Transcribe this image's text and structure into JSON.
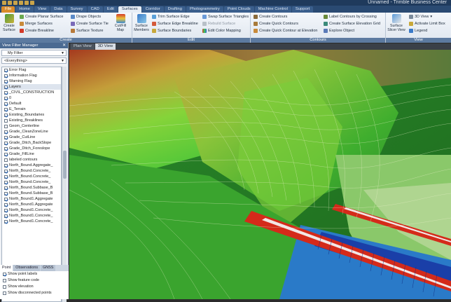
{
  "window": {
    "title": "Unnamed - Trimble Business Center"
  },
  "tabs": [
    "File",
    "Home",
    "View",
    "Data",
    "Survey",
    "CAD",
    "Edit",
    "Surfaces",
    "Corridor",
    "Drafting",
    "Photogrammetry",
    "Point Clouds",
    "Machine Control",
    "Support"
  ],
  "active_tab": "Surfaces",
  "ribbon": {
    "create": {
      "label": "Create",
      "big": "Create Surface",
      "items": [
        "Create Planar Surface",
        "Merge Surfaces",
        "Create Breakline",
        "Drape Objects",
        "Create Surface Tie",
        "Surface Texture"
      ],
      "cutfill": "Cut/Fill Map"
    },
    "edit": {
      "label": "Edit",
      "big": "Surface Members",
      "items": [
        "Trim Surface Edge",
        "Surface Edge Breakline",
        "Surface Boundaries",
        "Swap Surface Triangles",
        "Rebuild Surface",
        "Edit Color Mapping"
      ]
    },
    "contours": {
      "label": "Contours",
      "items": [
        "Create Contours",
        "Create Quick Contours",
        "Create Quick Contour at Elevation",
        "Label Contours by Crossing",
        "Create Surface Elevation Grid",
        "Explore Object"
      ]
    },
    "view": {
      "label": "View",
      "big": "Surface Slicer View",
      "items": [
        "3D View",
        "Activate Limit Box",
        "Legend"
      ]
    }
  },
  "panel": {
    "title": "View Filter Manager",
    "close": "✕",
    "filter": "My Filter",
    "everything": "<Everything>",
    "flags": [
      "Error Flag",
      "Information Flag",
      "Warning Flag"
    ],
    "layers_header": "Layers",
    "layers": [
      "_CIVIL_CONSTRUCTION",
      "0",
      "Default",
      "E_Terrain",
      "Existing_Boundaries",
      "Existing_Breaklines",
      "Geom_Centerline",
      "Grade_CleanZoneLine",
      "Grade_CutLine",
      "Grade_Ditch_BackSlope",
      "Grade_Ditch_Foreslope",
      "Grade_FillLine",
      "labeled contours",
      "North_Bound.Aggregate_",
      "North_Bound.Concrete_",
      "North_Bound.Concrete_",
      "North_Bound.Concrete_",
      "North_Bound.Subbase_B",
      "North_Bound.Subbase_B",
      "North_Bound1.Aggregate",
      "North_Bound1.Aggregate",
      "North_Bound1.Concrete_",
      "North_Bound1.Concrete_",
      "North_Bound1.Concrete_"
    ],
    "layers_checked": [
      true,
      true,
      true,
      true,
      true,
      false,
      false,
      true,
      true,
      true,
      true,
      true,
      false,
      true,
      true,
      true,
      true,
      true,
      true,
      true,
      true,
      true,
      true,
      true
    ],
    "bottom_tabs": [
      "Point",
      "Observations",
      "GNSS"
    ],
    "options": [
      "Show point labels",
      "Show feature code",
      "Show elevation",
      "Show disconnected points"
    ],
    "options_checked": [
      true,
      false,
      false,
      false
    ]
  },
  "view_tabs": [
    "Plan View",
    "3D View"
  ],
  "active_view": "3D View",
  "colors": {
    "accent": "#d98b2b",
    "ribbon_blue": "#2a4a72",
    "terrain_green": "#3c8a2a",
    "road_red": "#d42a1a",
    "water_blue": "#1a3fa8"
  }
}
